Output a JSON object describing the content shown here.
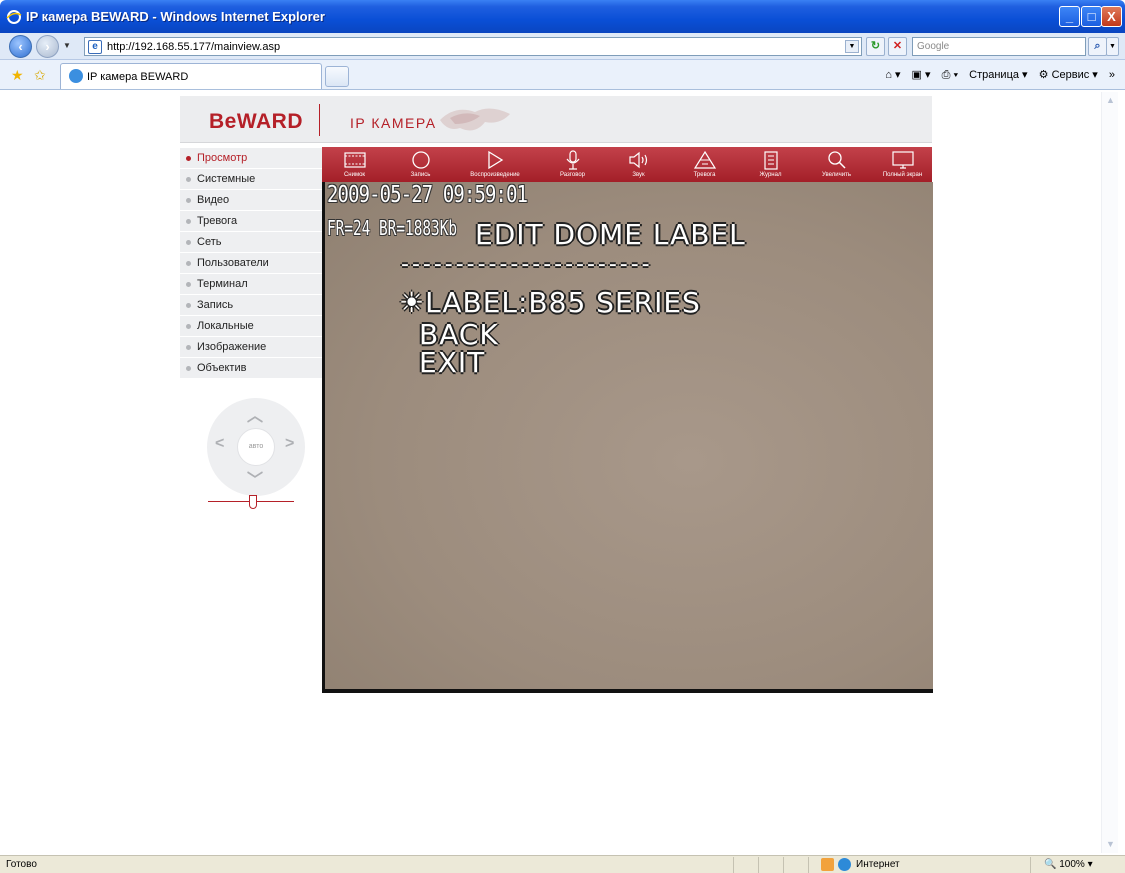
{
  "window": {
    "title": "IP камера BEWARD - Windows Internet Explorer",
    "minimize_label": "_",
    "maximize_label": "□",
    "close_label": "X"
  },
  "address": {
    "url": "http://192.168.55.177/mainview.asp",
    "search_placeholder": "Google"
  },
  "tabs": [
    {
      "title": "IP камера BEWARD"
    }
  ],
  "tools": {
    "page_label": "Страница",
    "service_label": "Сервис"
  },
  "header": {
    "logo": "BeWARD",
    "title": "IP КАМЕРА"
  },
  "menu": [
    {
      "label": "Просмотр",
      "active": true
    },
    {
      "label": "Системные"
    },
    {
      "label": "Видео"
    },
    {
      "label": "Тревога"
    },
    {
      "label": "Сеть"
    },
    {
      "label": "Пользователи"
    },
    {
      "label": "Терминал"
    },
    {
      "label": "Запись"
    },
    {
      "label": "Локальные"
    },
    {
      "label": "Изображение"
    },
    {
      "label": "Объектив"
    }
  ],
  "ptz": {
    "center_label": "авто",
    "up_icon": "chevron-up-icon",
    "down_icon": "chevron-down-icon",
    "left_icon": "chevron-left-icon",
    "right_icon": "chevron-right-icon"
  },
  "toolbar": [
    {
      "label": "Снимок",
      "icon": "film-icon"
    },
    {
      "label": "Запись",
      "icon": "record-icon"
    },
    {
      "label": "Воспроизведение",
      "icon": "play-icon"
    },
    {
      "label": "Разговор",
      "icon": "microphone-icon"
    },
    {
      "label": "Звук",
      "icon": "speaker-icon"
    },
    {
      "label": "Тревога",
      "icon": "alarm-icon"
    },
    {
      "label": "Журнал",
      "icon": "clipboard-icon"
    },
    {
      "label": "Увеличить",
      "icon": "magnifier-icon"
    },
    {
      "label": "Полный экран",
      "icon": "monitor-icon"
    }
  ],
  "video": {
    "timestamp": "2009-05-27 09:59:01",
    "stats": "FR=24 BR=1883Kb",
    "menu_title": "EDIT DOME LABEL",
    "dashes": "-----------------------",
    "label_line": "☀LABEL:B85 SERIES",
    "back": "BACK",
    "exit": "EXIT"
  },
  "status": {
    "ready": "Готово",
    "zone": "Интернет",
    "zoom": "100%"
  },
  "colors": {
    "brand_red": "#b52028",
    "titlebar_blue": "#0a4fd6"
  }
}
